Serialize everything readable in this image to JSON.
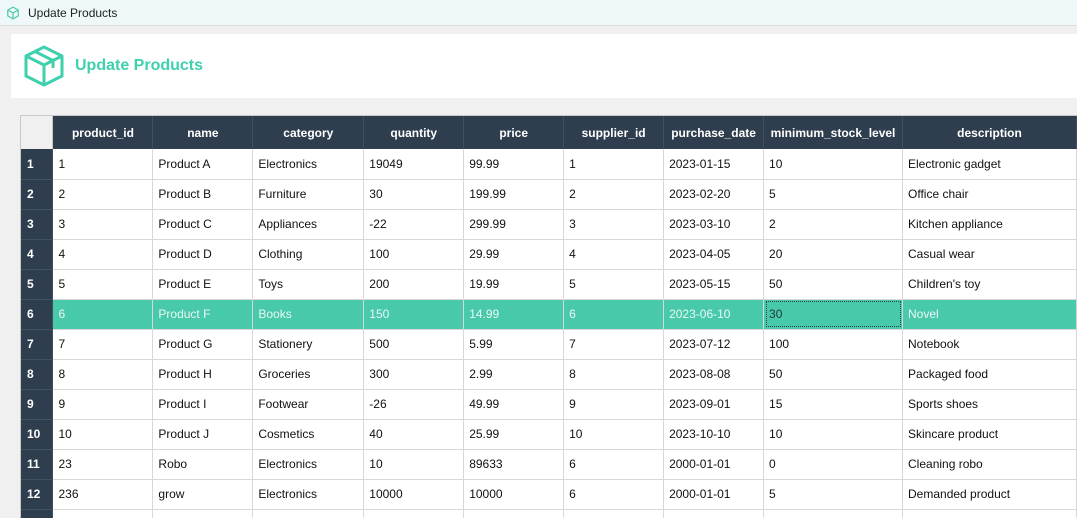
{
  "window": {
    "title": "Update Products",
    "icon": "cube-icon"
  },
  "header": {
    "title": "Update Products",
    "logo": "box-icon",
    "accent": "#3fd0ad"
  },
  "table": {
    "columns": [
      "product_id",
      "name",
      "category",
      "quantity",
      "price",
      "supplier_id",
      "purchase_date",
      "minimum_stock_level",
      "description"
    ],
    "selected_row_index": 5,
    "focused_column": "minimum_stock_level",
    "rows": [
      {
        "num": "1",
        "cells": [
          "1",
          "Product A",
          "Electronics",
          "19049",
          "99.99",
          "1",
          "2023-01-15",
          "10",
          "Electronic gadget"
        ]
      },
      {
        "num": "2",
        "cells": [
          "2",
          "Product B",
          "Furniture",
          "30",
          "199.99",
          "2",
          "2023-02-20",
          "5",
          "Office chair"
        ]
      },
      {
        "num": "3",
        "cells": [
          "3",
          "Product C",
          "Appliances",
          "-22",
          "299.99",
          "3",
          "2023-03-10",
          "2",
          "Kitchen appliance"
        ]
      },
      {
        "num": "4",
        "cells": [
          "4",
          "Product D",
          "Clothing",
          "100",
          "29.99",
          "4",
          "2023-04-05",
          "20",
          "Casual wear"
        ]
      },
      {
        "num": "5",
        "cells": [
          "5",
          "Product E",
          "Toys",
          "200",
          "19.99",
          "5",
          "2023-05-15",
          "50",
          "Children's toy"
        ]
      },
      {
        "num": "6",
        "cells": [
          "6",
          "Product F",
          "Books",
          "150",
          "14.99",
          "6",
          "2023-06-10",
          "30",
          "Novel"
        ]
      },
      {
        "num": "7",
        "cells": [
          "7",
          "Product G",
          "Stationery",
          "500",
          "5.99",
          "7",
          "2023-07-12",
          "100",
          "Notebook"
        ]
      },
      {
        "num": "8",
        "cells": [
          "8",
          "Product H",
          "Groceries",
          "300",
          "2.99",
          "8",
          "2023-08-08",
          "50",
          "Packaged food"
        ]
      },
      {
        "num": "9",
        "cells": [
          "9",
          "Product I",
          "Footwear",
          "-26",
          "49.99",
          "9",
          "2023-09-01",
          "15",
          "Sports shoes"
        ]
      },
      {
        "num": "10",
        "cells": [
          "10",
          "Product J",
          "Cosmetics",
          "40",
          "25.99",
          "10",
          "2023-10-10",
          "10",
          "Skincare product"
        ]
      },
      {
        "num": "11",
        "cells": [
          "23",
          "Robo",
          "Electronics",
          "10",
          "89633",
          "6",
          "2000-01-01",
          "0",
          "Cleaning robo"
        ]
      },
      {
        "num": "12",
        "cells": [
          "236",
          "grow",
          "Electronics",
          "10000",
          "10000",
          "6",
          "2000-01-01",
          "5",
          "Demanded product"
        ]
      },
      {
        "num": "",
        "cells": [
          "",
          "",
          "",
          "",
          "",
          "",
          "",
          "",
          ""
        ]
      }
    ]
  }
}
